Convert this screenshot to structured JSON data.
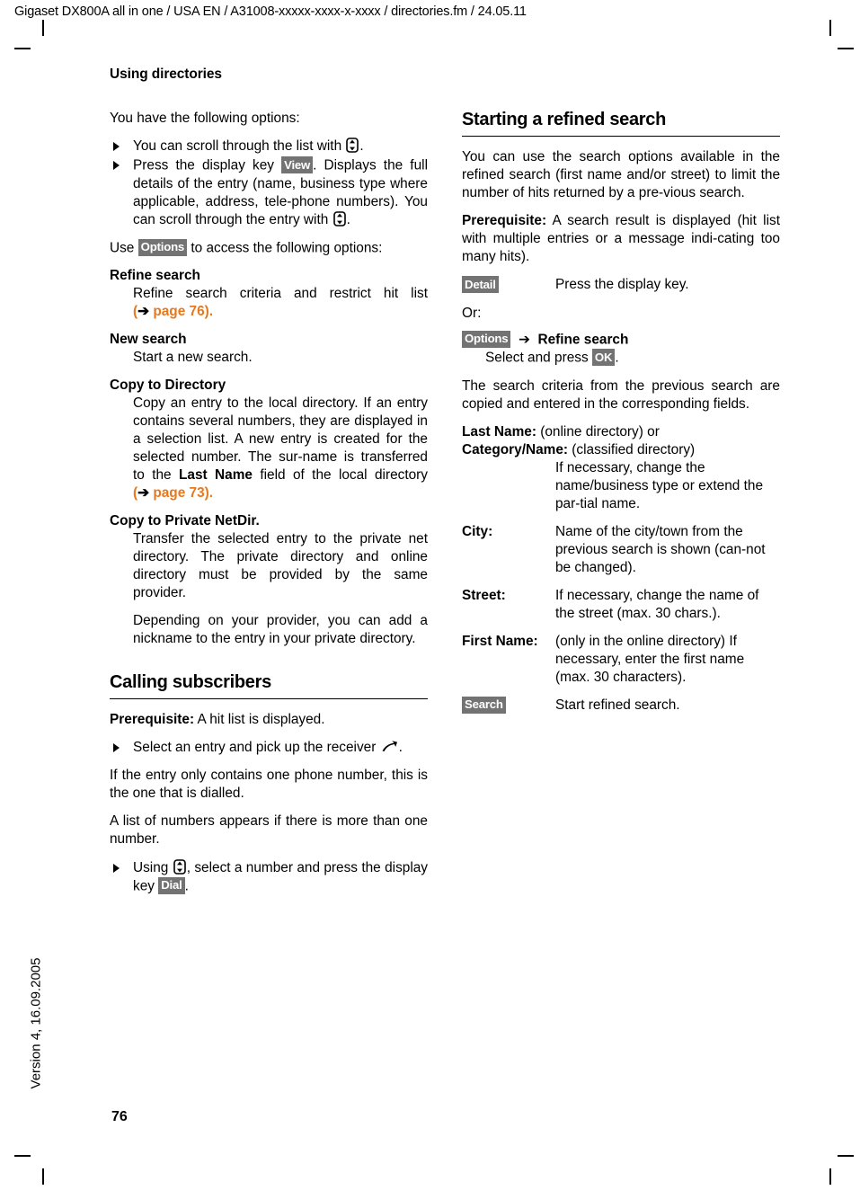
{
  "header": {
    "running_head": "Gigaset DX800A all in one / USA EN / A31008-xxxxx-xxxx-x-xxxx / directories.fm / 24.05.11"
  },
  "footer": {
    "version_stamp": "Version 4, 16.09.2005",
    "page_number": "76"
  },
  "chapter": {
    "title": "Using directories"
  },
  "colors": {
    "key_badge_bg": "#737373",
    "key_badge_text": "#ffffff",
    "cross_reference": "#E8781E",
    "text": "#000000"
  },
  "left_column": {
    "intro": "You have the following options:",
    "bullets": [
      {
        "text_before": "You can scroll through the list with ",
        "glyph": "control-key",
        "text_after": "."
      },
      {
        "text_before": "Press the display key ",
        "key": "View",
        "text_after": ". Displays the full details of the entry (name, business type where applicable, address, tele-phone numbers). You can scroll through the entry with ",
        "glyph2": "control-key",
        "text_end": "."
      }
    ],
    "options_lead_before": "Use ",
    "options_key": "Options",
    "options_lead_after": " to access the following options:",
    "options": [
      {
        "term": "Refine search",
        "desc_before": "Refine search criteria and restrict hit list ",
        "xref_open": "(",
        "xref_arrow": "➔",
        "xref_label": "page 76",
        "xref_close": ")."
      },
      {
        "term": "New search",
        "desc_before": "Start a new search."
      },
      {
        "term": "Copy to Directory",
        "desc_before": "Copy an entry to the local directory. If an entry contains several numbers, they are displayed in a selection list. A new entry is created for the selected number. The sur-name is transferred to the ",
        "desc_bold": "Last Name",
        "desc_mid": " field of the local directory ",
        "xref_open": "(",
        "xref_arrow": "➔",
        "xref_label": "page 73",
        "xref_close": ")."
      },
      {
        "term": "Copy to Private NetDir.",
        "desc_before": "Transfer the selected entry to the private net directory. The private directory and online directory must be provided by the same provider.",
        "desc_second": "Depending on your provider, you can add a nickname to the entry in your private directory."
      }
    ],
    "section2": {
      "heading": "Calling subscribers",
      "prereq_label": "Prerequisite:",
      "prereq_text": " A hit list is displayed.",
      "bullet1_before": "Select an entry and pick up the receiver ",
      "bullet1_glyph": "pick-up-receiver",
      "bullet1_after": ".",
      "para1": "If the entry only contains one phone number, this is the one that is dialled.",
      "para2": "A list of numbers appears if there is more than one number.",
      "bullet2_before": "Using ",
      "bullet2_glyph": "control-key",
      "bullet2_mid": ", select a number and press the display key ",
      "bullet2_key": "Dial",
      "bullet2_after": "."
    }
  },
  "right_column": {
    "heading": "Starting a refined search",
    "para1": "You can use the search options available in the refined search (first name and/or street) to limit the number of hits returned by a pre-vious search.",
    "prereq_label": "Prerequisite:",
    "prereq_text": " A search result is displayed (hit list with multiple entries or a message indi-cating too many hits).",
    "detail_row": {
      "key": "Detail",
      "desc": "Press the display key."
    },
    "or_label": "Or:",
    "options_row": {
      "key": "Options",
      "arrow": "➔",
      "bold_label": "Refine search",
      "sub_before": "Select and press ",
      "sub_key": "OK",
      "sub_after": "."
    },
    "para2": "The search criteria from the previous search are copied and entered in the corresponding fields.",
    "fields": [
      {
        "term": "Last Name:",
        "inline": " (online directory) or",
        "type": "span"
      },
      {
        "term": "Category/Name:",
        "inline": " (classified directory)",
        "type": "span"
      },
      {
        "type": "hang",
        "desc": "If necessary, change the name/business type or extend the par-tial name."
      },
      {
        "type": "row",
        "term": "City:",
        "desc": "Name of the city/town from the previous search is shown (can-not be changed)."
      },
      {
        "type": "row",
        "term": "Street:",
        "desc": "If necessary, change the name of the street (max. 30 chars.)."
      },
      {
        "type": "row",
        "term": "First Name:",
        "desc": "(only in the online directory) If necessary, enter the first name (max. 30 characters)."
      },
      {
        "type": "keyrow",
        "key": "Search",
        "desc": "Start refined search."
      }
    ]
  }
}
